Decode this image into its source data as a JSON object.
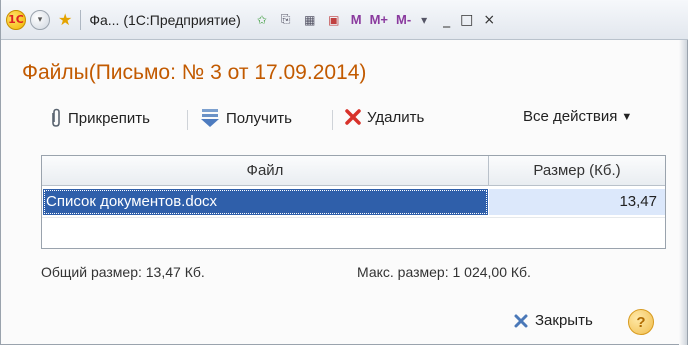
{
  "titlebar": {
    "title": "Фа... (1С:Предприятие)",
    "btn_m": "M",
    "btn_mplus": "M+",
    "btn_mminus": "M-",
    "win_minimize": "_",
    "win_maximize": "□",
    "win_close": "×"
  },
  "form": {
    "title": "Файлы(Письмо: № 3 от 17.09.2014)"
  },
  "toolbar": {
    "attach": "Прикрепить",
    "get": "Получить",
    "delete": "Удалить",
    "all_actions": "Все действия"
  },
  "table": {
    "columns": [
      "Файл",
      "Размер (Кб.)"
    ],
    "rows": [
      {
        "file": "Список документов.docx",
        "size": "13,47"
      }
    ]
  },
  "footer": {
    "total": "Общий размер: 13,47 Кб.",
    "max": "Макс. размер: 1 024,00 Кб.",
    "close": "Закрыть",
    "help": "?"
  },
  "colors": {
    "title_accent": "#c25a00",
    "selection": "#2f5faa",
    "selection_size_cell": "#dce8fb"
  }
}
